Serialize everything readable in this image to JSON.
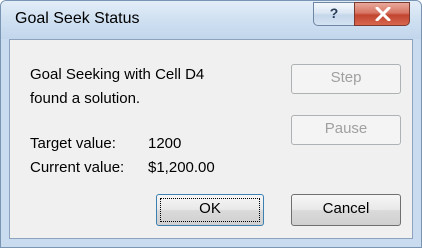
{
  "window": {
    "title": "Goal Seek Status",
    "help_icon": "question-mark-icon",
    "help_glyph": "?",
    "close_icon": "close-x-icon",
    "title_color": "#c9dcef",
    "close_color": "#c1452f"
  },
  "message": {
    "line1": "Goal Seeking with Cell D4",
    "line2": "found a solution."
  },
  "values": {
    "target_label": "Target value:",
    "target_value": "1200",
    "current_label": "Current value:",
    "current_value": "$1,200.00"
  },
  "buttons": {
    "step": "Step",
    "pause": "Pause",
    "ok": "OK",
    "cancel": "Cancel"
  }
}
